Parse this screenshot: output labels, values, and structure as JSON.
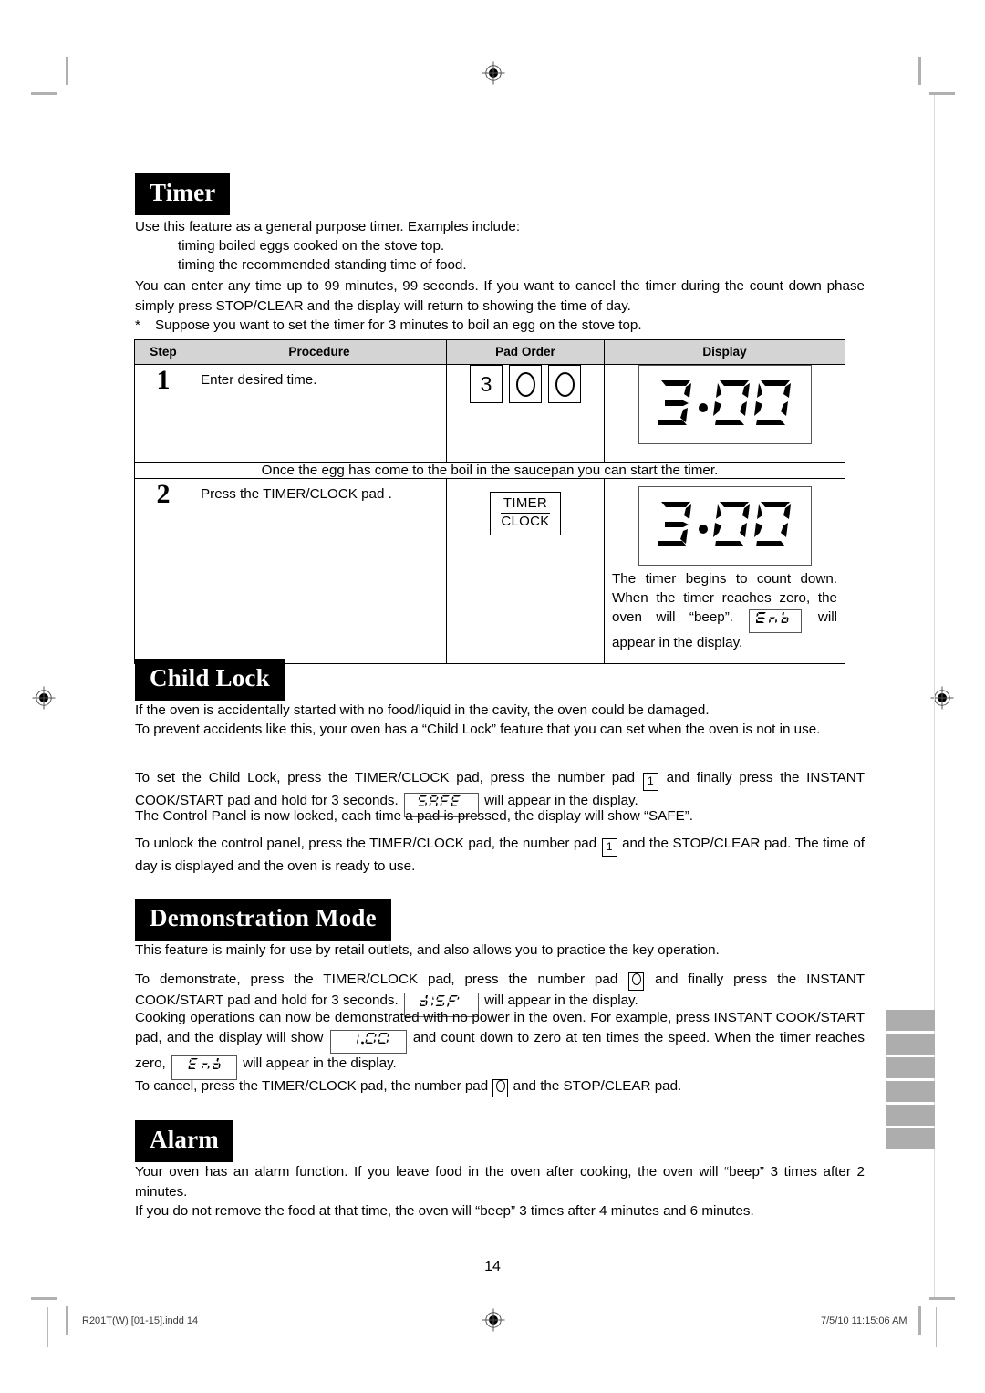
{
  "document": {
    "page_number": "14",
    "footer_left": "R201T(W) [01-15].indd   14",
    "footer_right": "7/5/10   11:15:06 AM"
  },
  "sections": {
    "timer": {
      "banner": "Timer",
      "intro": "Use this feature as a general purpose timer. Examples include:",
      "bullets": [
        "timing boiled eggs cooked on the stove top.",
        "timing the recommended standing time of food."
      ],
      "body": "You can enter any time up to 99 minutes, 99 seconds. If you want to cancel the timer during the count down phase simply press STOP/CLEAR and the display will return to showing the time of day.",
      "example_marker": "*",
      "example": "Suppose you want to set the timer for 3 minutes to boil an egg on the stove top.",
      "table": {
        "headers": [
          "Step",
          "Procedure",
          "Pad Order",
          "Display"
        ],
        "rows": [
          {
            "step": "1",
            "procedure": "Enter desired time.",
            "pads": [
              "3",
              "circle-o",
              "circle-o"
            ],
            "display": "3.00",
            "note": ""
          },
          {
            "step": "2",
            "procedure": "Press the TIMER/CLOCK pad .",
            "pad_label_line1": "TIMER",
            "pad_label_line2": "CLOCK",
            "display": "3.00",
            "note_part1": "The timer begins to count down. When the timer reaches zero, the oven will “beep”. ",
            "note_lcd": "End",
            "note_part2": " will appear in the display."
          }
        ],
        "bridge_text": "Once the egg has come to the boil in the saucepan you can start the timer."
      }
    },
    "child_lock": {
      "banner": "Child Lock",
      "p1": "If the oven is accidentally started with no food/liquid in the cavity, the oven could be damaged.",
      "p2": "To prevent accidents like this, your oven has a “Child Lock” feature that you can set when the oven is not in use.",
      "p3_a": "To set the Child Lock, press the TIMER/CLOCK pad, press the number pad ",
      "p3_pad": "1",
      "p3_b": " and finally press the INSTANT COOK/START pad and hold for 3 seconds. ",
      "p3_lcd": "SAFE",
      "p3_c": " will appear in the display.",
      "p4": "The Control Panel is now locked, each time a pad is pressed, the display will show “SAFE”.",
      "p5_a": "To unlock the control panel, press the TIMER/CLOCK pad, the number pad ",
      "p5_pad": "1",
      "p5_b": " and the STOP/CLEAR pad. The time of day is displayed and the oven is ready to use."
    },
    "demonstration_mode": {
      "banner": "Demonstration Mode",
      "p1": "This feature is mainly for use by retail outlets, and also allows you to practice the key operation.",
      "p2_a": "To demonstrate, press the TIMER/CLOCK pad, press the number pad ",
      "p2_pad": "circle-o",
      "p2_b": " and finally press the INSTANT COOK/START pad and hold for 3 seconds. ",
      "p2_lcd": "dISP",
      "p2_c": " will appear in the display.",
      "p3_a": "Cooking operations can now be demonstrated with no power in the oven. For example, press INSTANT COOK/START pad, and the display will show ",
      "p3_lcd": "1:00",
      "p3_b": " and count down to zero at ten times the speed. When the timer reaches zero, ",
      "p3_lcd2": "End",
      "p3_c": " will appear in the display.",
      "p4_a": "To cancel, press the TIMER/CLOCK pad, the number pad ",
      "p4_pad": "circle-o",
      "p4_b": " and the STOP/CLEAR pad."
    },
    "alarm": {
      "banner": "Alarm",
      "p1": "Your oven has an alarm function. If you leave food in the oven after cooking, the oven will “beep” 3 times after 2 minutes.",
      "p2": "If you do not remove the food at that time, the oven will “beep” 3 times after 4 minutes and 6 minutes."
    }
  },
  "marks": {
    "registration_icon": "registration-target-icon",
    "tab_count": 6,
    "tab_color": "#adadad"
  }
}
